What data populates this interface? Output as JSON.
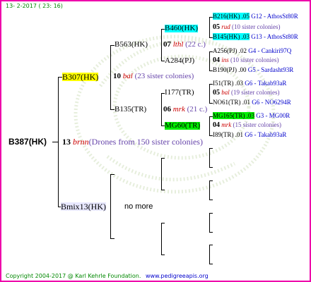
{
  "header": {
    "date": "13- 2-2017 ( 23: 16)"
  },
  "footer": {
    "copyright": "Copyright 2004-2017 @ Karl Kehrle Foundation.",
    "site": "www.pedigreeapis.org"
  },
  "root": {
    "label": "B387(HK)"
  },
  "gen1": [
    {
      "label": "B307(HK)",
      "number": "13",
      "code": "brnn",
      "note": "(Drones from 150 sister colonies)"
    },
    {
      "label": "Bmix13(HK)",
      "note": "no more"
    }
  ],
  "gen2": [
    {
      "label": "B563(HK)",
      "number": "10",
      "code": "bal",
      "note": "(23 sister colonies)"
    },
    {
      "label": "B135(TR)"
    }
  ],
  "gen3": [
    {
      "label": "B460(HK)",
      "number": "07",
      "code": "lthl",
      "note": "(22 c.)"
    },
    {
      "label": "A284(PJ)"
    },
    {
      "label": "I177(TR)",
      "number": "06",
      "code": "mrk",
      "note": "(21 c.)"
    },
    {
      "label": "MG60(TR)"
    }
  ],
  "gen4": [
    {
      "label": "B216(HK) .05",
      "ref": "G12 - AthosSt80R",
      "number": "05",
      "code": "rud",
      "note": "(10 sister colonies)"
    },
    {
      "label": "B145(HK) .03",
      "ref": "G13 - AthosSt80R"
    },
    {
      "label": "A256(PJ) .02",
      "ref": "G4 - Cankiri97Q",
      "number": "04",
      "code": "ins",
      "note": "(10 sister colonies)"
    },
    {
      "label": "B190(PJ) .00",
      "ref": "G5 - Sardasht93R"
    },
    {
      "label": "I51(TR) .03",
      "ref": "G6 - Takab93aR",
      "number": "05",
      "code": "bal",
      "note": "(19 sister colonies)"
    },
    {
      "label": "NO61(TR) .01",
      "ref": "G6 - NO6294R"
    },
    {
      "label": "MG165(TR) .03",
      "ref": "G3 - MG00R",
      "number": "04",
      "code": "mrk",
      "note": "(15 sister colonies)"
    },
    {
      "label": "I89(TR) .01",
      "ref": "G6 - Takab93aR"
    }
  ],
  "colors": {
    "border": "#ee00aa",
    "header_text": "#008800",
    "highlight_yellow": "#ffff00",
    "highlight_cyan": "#00ffff",
    "highlight_green": "#00ee00",
    "drone_code": "#cc0000",
    "note": "#6644aa",
    "ref": "#0000cc"
  }
}
